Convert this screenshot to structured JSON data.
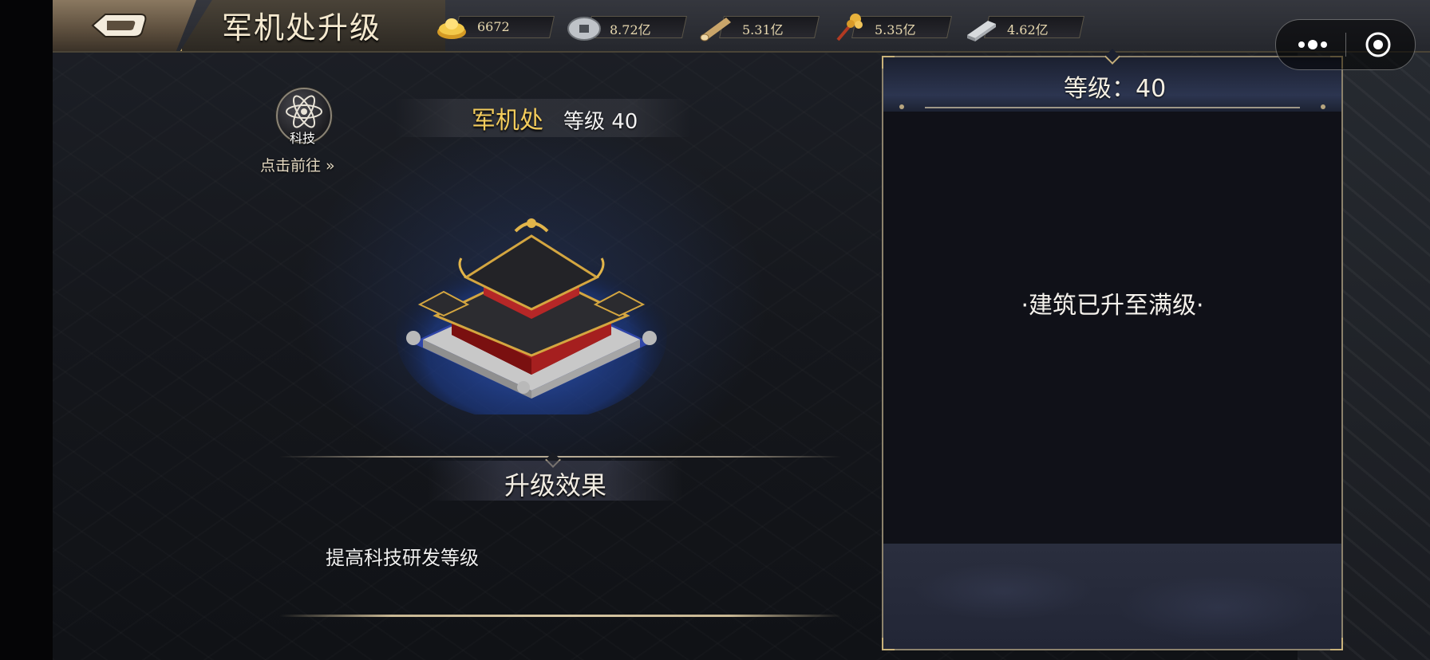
{
  "header": {
    "title": "军机处升级"
  },
  "resources": [
    {
      "name": "gold-ingot",
      "value": "6672"
    },
    {
      "name": "copper-coin",
      "value": "8.72亿"
    },
    {
      "name": "wood",
      "value": "5.31亿"
    },
    {
      "name": "grain",
      "value": "5.35亿"
    },
    {
      "name": "iron",
      "value": "4.62亿"
    }
  ],
  "tech_shortcut": {
    "icon_label": "科技",
    "goto_label": "点击前往 »"
  },
  "building": {
    "name": "军机处",
    "level_text": "等级 40"
  },
  "effect": {
    "title": "升级效果",
    "description": "提高科技研发等级"
  },
  "info_panel": {
    "level_text": "等级：40",
    "status_text": "·建筑已升至满级·"
  },
  "colors": {
    "building_name": "#f3cc5c",
    "panel_border": "#8c826c",
    "accent_gold": "#c9b27a"
  }
}
